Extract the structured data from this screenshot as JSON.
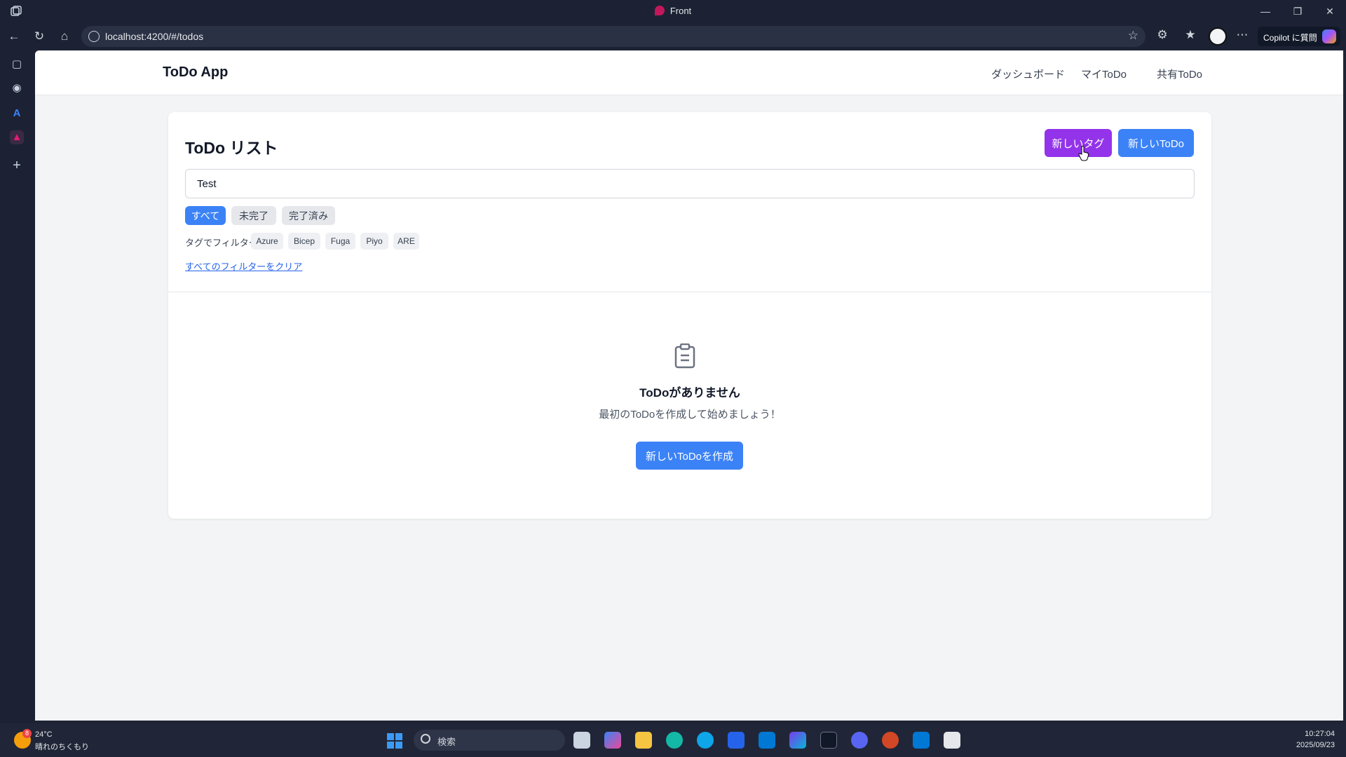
{
  "window": {
    "title": "Front"
  },
  "browser": {
    "url": "localhost:4200/#/todos",
    "copilot_label": "Copilot に質問"
  },
  "app": {
    "brand": "ToDo App",
    "nav": [
      "ダッシュボード",
      "マイToDo",
      "共有ToDo"
    ]
  },
  "todo_list": {
    "title": "ToDo リスト",
    "new_tag_label": "新しいタグ",
    "new_todo_label": "新しいToDo",
    "search_value": "Test",
    "status_filters": [
      {
        "label": "すべて",
        "active": true
      },
      {
        "label": "未完了",
        "active": false
      },
      {
        "label": "完了済み",
        "active": false
      }
    ],
    "tag_filter_label": "タグでフィルター:",
    "tags": [
      "Azure",
      "Bicep",
      "Fuga",
      "Piyo",
      "ARE"
    ],
    "clear_filters_label": "すべてのフィルターをクリア"
  },
  "empty_state": {
    "icon": "clipboard-list-icon",
    "title": "ToDoがありません",
    "subtitle": "最初のToDoを作成して始めましょう！",
    "create_label": "新しいToDoを作成"
  },
  "taskbar": {
    "weather_badge": "8",
    "temperature": "24°C",
    "weather": "晴れのちくもり",
    "search_placeholder": "検索",
    "time": "10:27:04",
    "date": "2025/09/23"
  },
  "colors": {
    "primary": "#3b82f6",
    "accent_purple": "#9333ea",
    "link": "#2563eb"
  }
}
